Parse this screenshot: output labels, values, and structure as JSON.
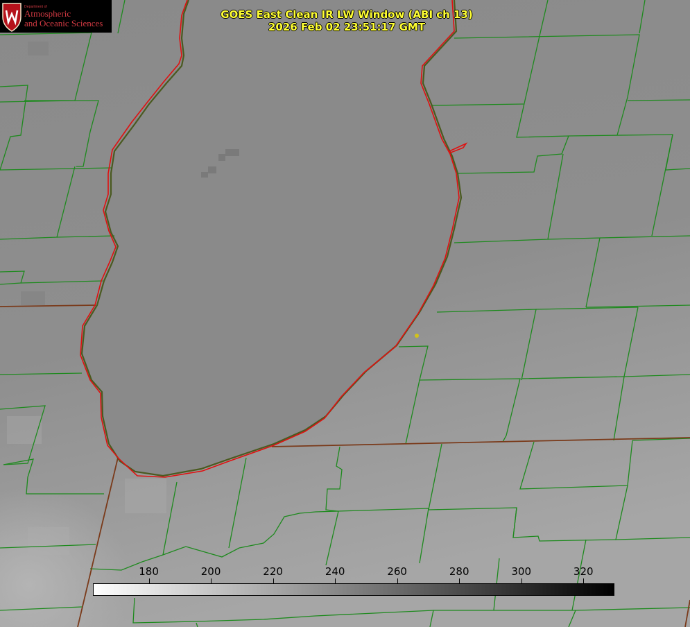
{
  "title": {
    "line1": "GOES East Clean IR LW Window (ABI ch 13)",
    "line2": "2026 Feb 02 23:51:17 GMT",
    "color": "#ffff33"
  },
  "logo": {
    "department": "Department of",
    "line1": "Atmospheric",
    "line2": "and Oceanic Sciences",
    "seal_letter": "W",
    "text_color": "#d33a43",
    "seal_color": "#b5121b"
  },
  "colorbar": {
    "ticks": [
      "180",
      "200",
      "220",
      "240",
      "260",
      "280",
      "300",
      "320"
    ],
    "min_value": 162,
    "max_value": 330,
    "gradient_from": "#ffffff",
    "gradient_to": "#000000"
  },
  "map_style": {
    "county_line_color": "#1e8a1e",
    "state_line_color": "#7a3a1a",
    "lake_outline_color": "#e01010",
    "point_marker_color": "#d2c21a",
    "lake_fill": "#8a8a8a",
    "land_fill": "#8d8d8d"
  }
}
